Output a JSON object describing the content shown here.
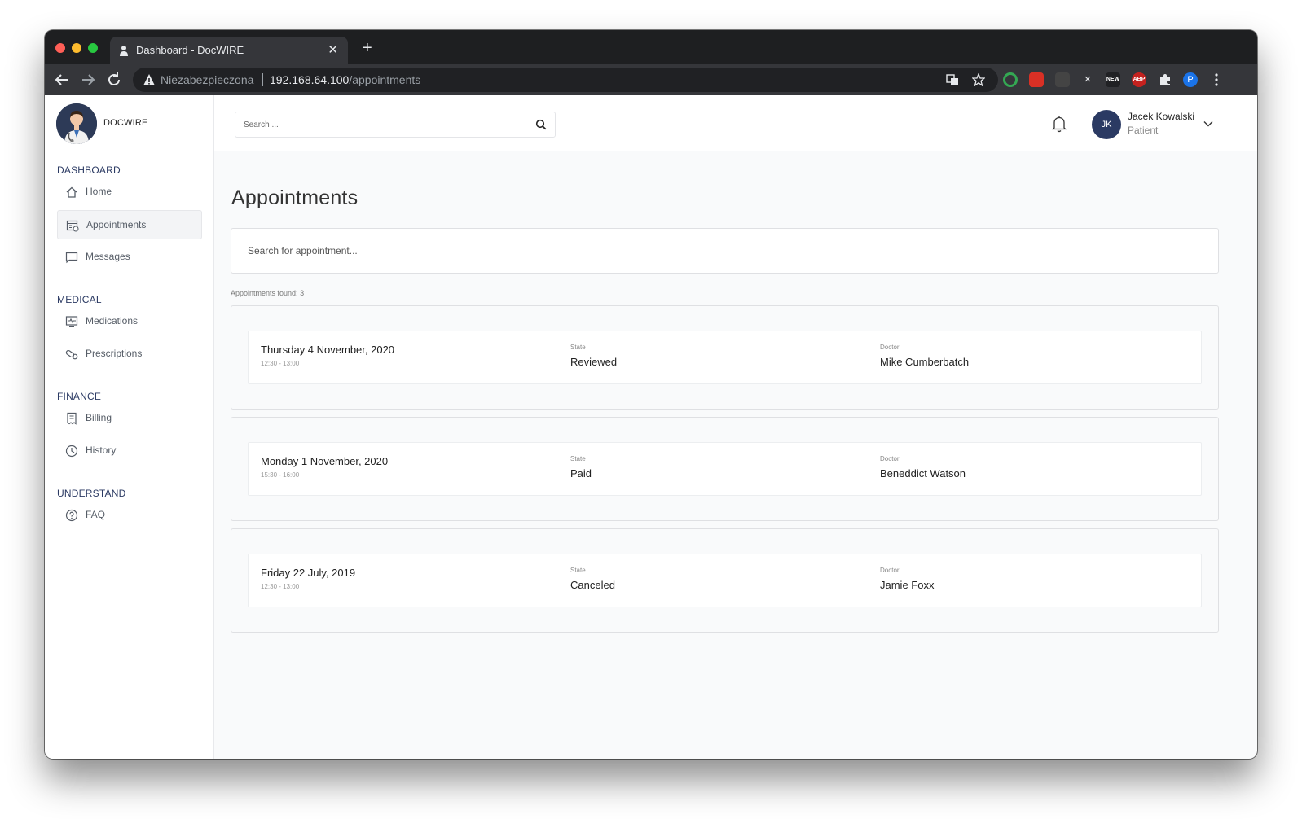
{
  "browser": {
    "tab_title": "Dashboard - DocWIRE",
    "tab_close": "✕",
    "new_tab": "+",
    "insecure_label": "Niezabezpieczona",
    "url_host": "192.168.64.100",
    "url_path": "/appointments",
    "profile_initial": "P",
    "ext_new": "NEW",
    "ext_abp": "ABP"
  },
  "brand": {
    "name": "DOCWIRE"
  },
  "sidebar": {
    "sections": [
      {
        "title": "DASHBOARD",
        "items": [
          {
            "label": "Home",
            "icon": "home-icon"
          },
          {
            "label": "Appointments",
            "icon": "calendar-icon",
            "active": true
          },
          {
            "label": "Messages",
            "icon": "message-icon"
          }
        ]
      },
      {
        "title": "MEDICAL",
        "items": [
          {
            "label": "Medications",
            "icon": "monitor-pulse-icon"
          },
          {
            "label": "Prescriptions",
            "icon": "pills-icon"
          }
        ]
      },
      {
        "title": "FINANCE",
        "items": [
          {
            "label": "Billing",
            "icon": "receipt-icon"
          },
          {
            "label": "History",
            "icon": "clock-icon"
          }
        ]
      },
      {
        "title": "UNDERSTAND",
        "items": [
          {
            "label": "FAQ",
            "icon": "question-icon"
          }
        ]
      }
    ]
  },
  "header": {
    "search_placeholder": "Search ...",
    "user": {
      "initials": "JK",
      "name": "Jacek Kowalski",
      "role": "Patient"
    }
  },
  "main": {
    "title": "Appointments",
    "search_placeholder": "Search for appointment...",
    "found_label": "Appointments found:",
    "found_count": "3",
    "state_label": "State",
    "doctor_label": "Doctor",
    "appointments": [
      {
        "date": "Thursday 4 November, 2020",
        "time": "12:30 - 13:00",
        "state": "Reviewed",
        "doctor": "Mike Cumberbatch"
      },
      {
        "date": "Monday 1 November, 2020",
        "time": "15:30 - 16:00",
        "state": "Paid",
        "doctor": "Beneddict Watson"
      },
      {
        "date": "Friday 22 July, 2019",
        "time": "12:30 - 13:00",
        "state": "Canceled",
        "doctor": "Jamie Foxx"
      }
    ]
  }
}
